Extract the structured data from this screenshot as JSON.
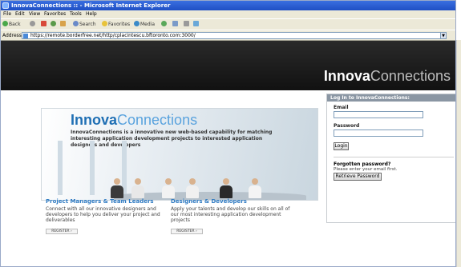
{
  "window": {
    "title": "InnovaConnections :: - Microsoft Internet Explorer"
  },
  "menu": {
    "items": [
      "File",
      "Edit",
      "View",
      "Favorites",
      "Tools",
      "Help"
    ]
  },
  "toolbar": {
    "back": "Back",
    "search": "Search",
    "favorites": "Favorites",
    "media": "Media"
  },
  "address": {
    "label": "Address",
    "url": "https://remote.borderfree.net/http/cplacintescu.bftoronto.com:3000/"
  },
  "site": {
    "brand_bold": "Innova",
    "brand_light": "Connections",
    "hero_logo_bold": "Innova",
    "hero_logo_light": "Connections",
    "hero_description": "InnovaConnections is a innovative new web-based capability for matching interesting application development projects to interested application designers and developers"
  },
  "login": {
    "heading": "Log In to InnovaConnections:",
    "email_label": "Email",
    "password_label": "Password",
    "login_button": "Login",
    "forgot_title": "Forgotten password?",
    "forgot_help": "Please enter your email first.",
    "retrieve_button": "Retrieve Password"
  },
  "columns": [
    {
      "title": "Project Managers & Team Leaders",
      "text": "Connect with all our innovative designers and developers to help you deliver your project and deliverables",
      "button": "REGISTER"
    },
    {
      "title": "Designers & Developers",
      "text": "Apply your talents and develop our skills on all of our most interesting application development projects",
      "button": "REGISTER"
    }
  ],
  "colors": {
    "titlebar": "#1f4fc4",
    "banner": "#1a1a1a",
    "accent_blue": "#2e7ac2",
    "login_header": "#8a96a3"
  }
}
